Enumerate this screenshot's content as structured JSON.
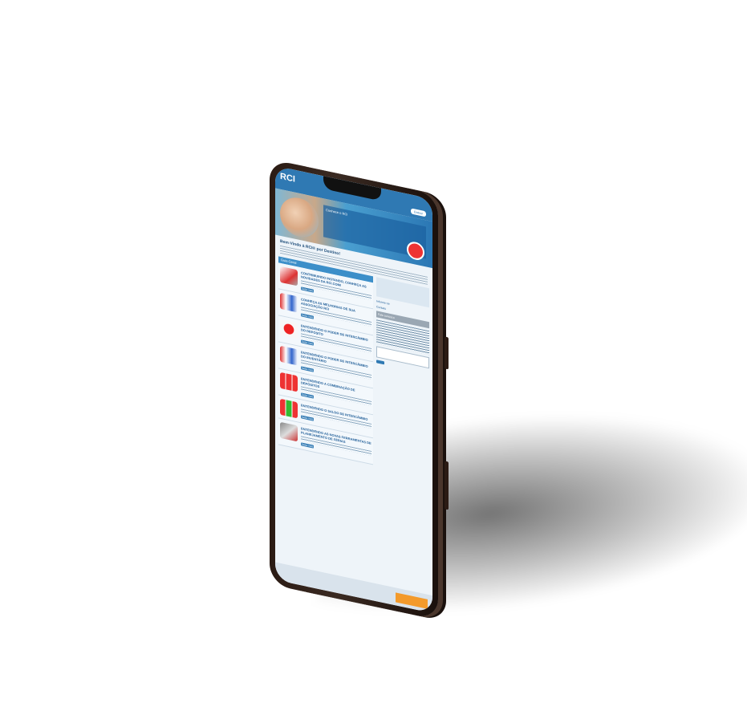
{
  "brand": {
    "logo": "RCI"
  },
  "header": {
    "signin_label": "Entrar"
  },
  "hero": {
    "text": "Conhece o RCI"
  },
  "welcome": {
    "title": "Bem-Vindo à RCI® por Destino!"
  },
  "section": {
    "label": "Guia Geral"
  },
  "cards": [
    {
      "title": "CONTRIBUINDO INSTANDO, CONHEÇA AS NOVIDADES DA RCI.COM!",
      "button": "Saiba mais"
    },
    {
      "title": "CONHEÇA AS MELHORIAS DE SUA ASSOCIAÇÃO RCI",
      "button": "Saiba mais"
    },
    {
      "title": "ENTENDENDO O PODER DE INTERCÂMBIO DO DEPÓSITO",
      "button": "Saiba mais"
    },
    {
      "title": "ENTENDENDO O PODER DE INTERCÂMBIO DO INVENTÁRIO",
      "button": "Saiba mais"
    },
    {
      "title": "ENTENDENDO A COMBINAÇÃO DE DEPÓSITOS",
      "button": "Saiba mais"
    },
    {
      "title": "ENTENDENDO O SALDO DE INTERCÂMBIO",
      "button": "Saiba mais"
    },
    {
      "title": "ENTENDENDO AS NOVAS FERRAMENTAS DE PLANEJAMENTO DE FÉRIAS",
      "button": "Saiba mais"
    }
  ],
  "sidebar": {
    "link1": "Informe-se",
    "link2": "Contato",
    "head": "Fale conosco"
  },
  "colors": {
    "accent": "#2f79b3",
    "orange": "#f39a2b"
  }
}
